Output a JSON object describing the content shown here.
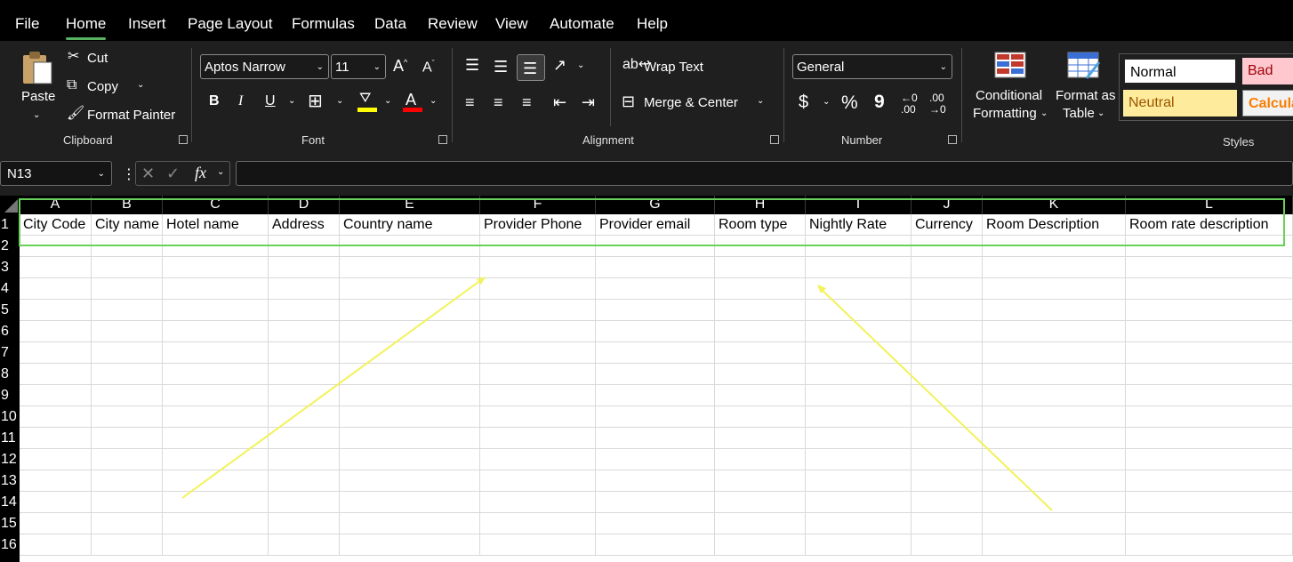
{
  "menu": [
    "File",
    "Home",
    "Insert",
    "Page Layout",
    "Formulas",
    "Data",
    "Review",
    "View",
    "Automate",
    "Help"
  ],
  "menu_active": "Home",
  "clipboard": {
    "paste": "Paste",
    "cut": "Cut",
    "copy": "Copy",
    "format_painter": "Format Painter",
    "group": "Clipboard"
  },
  "font": {
    "name": "Aptos Narrow",
    "size": "11",
    "bold": "B",
    "italic": "I",
    "underline": "U",
    "group": "Font",
    "fill_color": "#ffff00",
    "font_color": "#ff0000"
  },
  "alignment": {
    "wrap": "Wrap Text",
    "merge": "Merge & Center",
    "group": "Alignment"
  },
  "number": {
    "format": "General",
    "dollar": "$",
    "percent": "%",
    "comma": "9",
    "group": "Number"
  },
  "styles": {
    "conditional_line1": "Conditional",
    "conditional_line2": "Formatting",
    "table_line1": "Format as",
    "table_line2": "Table",
    "normal": "Normal",
    "bad": "Bad",
    "neutral": "Neutral",
    "calc": "Calcula",
    "group": "Styles"
  },
  "formula_bar": {
    "name_box": "N13",
    "fx": "fx",
    "value": ""
  },
  "columns": [
    "A",
    "B",
    "C",
    "D",
    "E",
    "F",
    "G",
    "H",
    "I",
    "J",
    "K",
    "L"
  ],
  "rows": [
    "1",
    "2",
    "3",
    "4",
    "5",
    "6",
    "7",
    "8",
    "9",
    "10",
    "11",
    "12",
    "13",
    "14",
    "15",
    "16"
  ],
  "header_row": [
    "City Code",
    "City name",
    "Hotel name",
    "Address",
    "Country name",
    "Provider Phone",
    "Provider email",
    "Room type",
    "Nightly Rate",
    "Currency",
    "Room Description",
    "Room rate description"
  ],
  "colors": {
    "accent_green": "#58b463",
    "selection_green": "#66d25a",
    "arrow_yellow": "#f2f25a",
    "neutral_bg": "#ffeb9c",
    "neutral_text": "#9c5700",
    "bad_bg": "#ffc7ce",
    "bad_text": "#9c0006",
    "calc_text": "#fa7d00"
  }
}
